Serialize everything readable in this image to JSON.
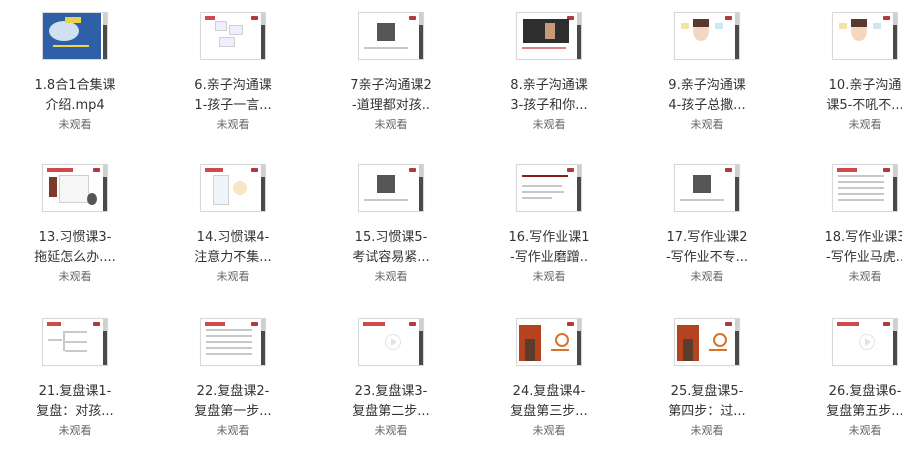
{
  "items": [
    {
      "line1": "1.8合1合集课",
      "line2": "介绍.mp4",
      "status": "未观看",
      "thumb": "blue-cover"
    },
    {
      "line1": "6.亲子沟通课",
      "line2": "1-孩子一言...",
      "status": "未观看",
      "thumb": "flow-slide"
    },
    {
      "line1": "7亲子沟通课2",
      "line2": "-道理都对孩..",
      "status": "未观看",
      "thumb": "photo-slide"
    },
    {
      "line1": "8.亲子沟通课",
      "line2": "3-孩子和你...",
      "status": "未观看",
      "thumb": "dark-photo-slide"
    },
    {
      "line1": "9.亲子沟通课",
      "line2": "4-孩子总撒...",
      "status": "未观看",
      "thumb": "cartoon-slide"
    },
    {
      "line1": "10.亲子沟通",
      "line2": "课5-不吼不...",
      "status": "未观看",
      "thumb": "cartoon-slide-2"
    },
    {
      "line1": "13.习惯课3-",
      "line2": "拖延怎么办....",
      "status": "未观看",
      "thumb": "drawing-slide"
    },
    {
      "line1": "14.习惯课4-",
      "line2": "注意力不集...",
      "status": "未观看",
      "thumb": "diagram-slide"
    },
    {
      "line1": "15.习惯课5-",
      "line2": "考试容易紧...",
      "status": "未观看",
      "thumb": "photo-slide-2"
    },
    {
      "line1": "16.写作业课1",
      "line2": "-写作业磨蹭..",
      "status": "未观看",
      "thumb": "text-slide"
    },
    {
      "line1": "17.写作业课2",
      "line2": "-写作业不专...",
      "status": "未观看",
      "thumb": "photo-slide-3"
    },
    {
      "line1": "18.写作业课3",
      "line2": "-写作业马虎..",
      "status": "未观看",
      "thumb": "table-slide"
    },
    {
      "line1": "21.复盘课1-",
      "line2": "复盘：对孩...",
      "status": "未观看",
      "thumb": "tree-slide"
    },
    {
      "line1": "22.复盘课2-",
      "line2": "复盘第一步...",
      "status": "未观看",
      "thumb": "table-slide-2"
    },
    {
      "line1": "23.复盘课3-",
      "line2": "复盘第二步...",
      "status": "未观看",
      "thumb": "blank-slide"
    },
    {
      "line1": "24.复盘课4-",
      "line2": "复盘第三步...",
      "status": "未观看",
      "thumb": "autumn-slide"
    },
    {
      "line1": "25.复盘课5-",
      "line2": "第四步：过...",
      "status": "未观看",
      "thumb": "autumn-slide-2"
    },
    {
      "line1": "26.复盘课6-",
      "line2": "复盘第五步...",
      "status": "未观看",
      "thumb": "blank-slide-2"
    }
  ]
}
